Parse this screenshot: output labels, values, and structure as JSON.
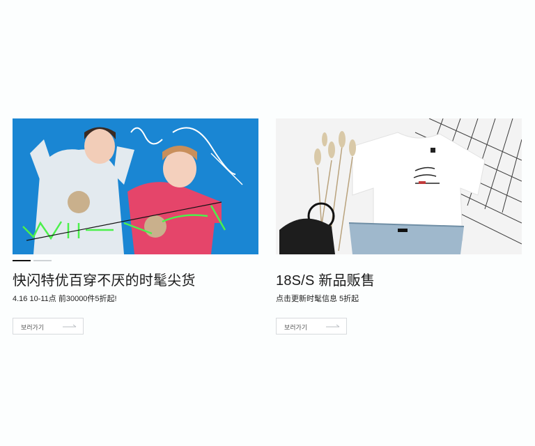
{
  "cards": [
    {
      "title": "快闪特优百穿不厌的时髦尖货",
      "subtitle": "4.16 10-11点 前30000件5折起!",
      "button_label": "보러가기",
      "banner_colors": {
        "background": "#1a86d3",
        "shirt_left": "#dfe8ee",
        "shirt_right": "#e5456a",
        "accent": "#4cf04c"
      }
    },
    {
      "title": "18S/S 新品贩售",
      "subtitle": "点击更新时髦信息 5折起",
      "button_label": "보러가기",
      "banner_colors": {
        "background": "#f3f3f3",
        "shirt": "#ffffff",
        "denim": "#9fb8cc",
        "bag": "#1d1d1d"
      }
    }
  ]
}
